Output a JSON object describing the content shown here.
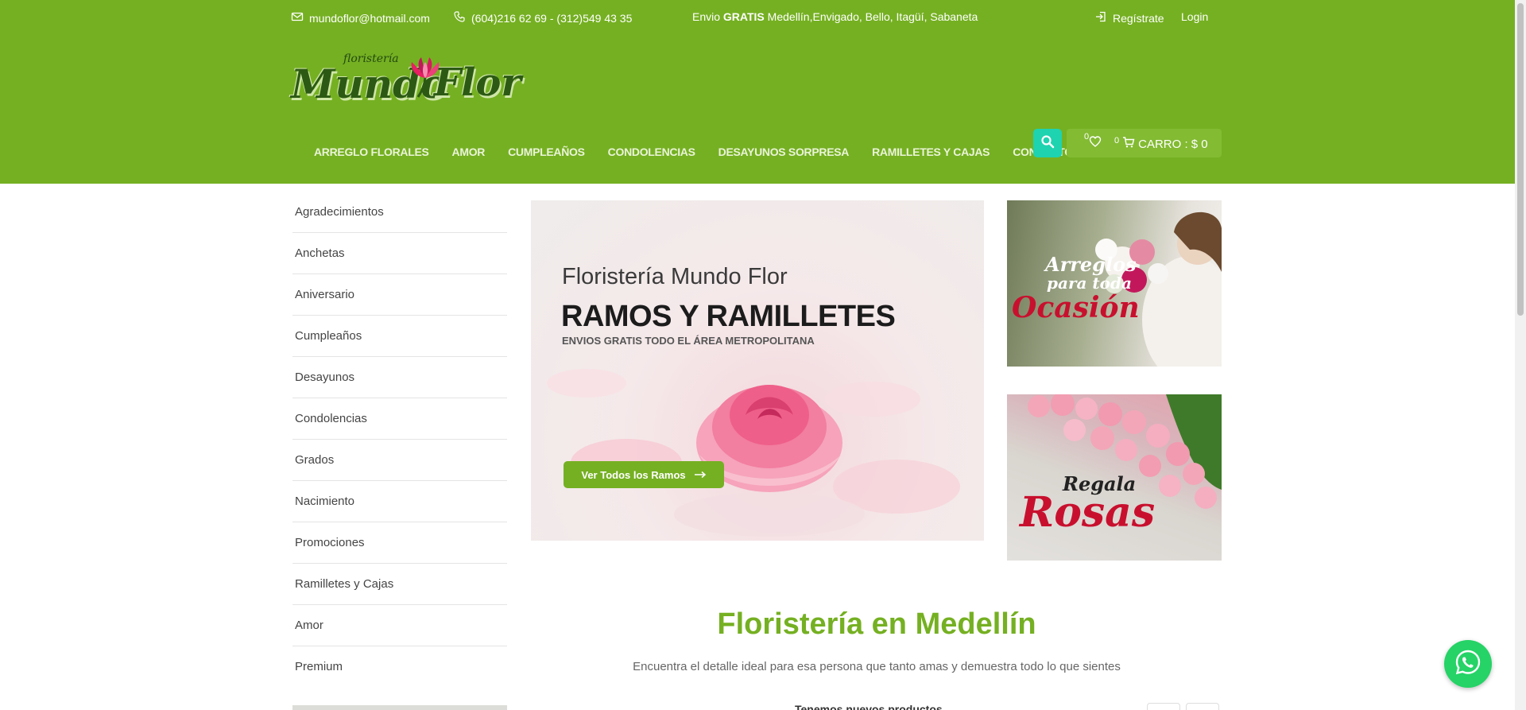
{
  "topbar": {
    "email": "mundoflor@hotmail.com",
    "phone": "(604)216 62 69 - (312)549 43 35",
    "shipping_prefix": "Envio",
    "shipping_bold": "GRATIS",
    "shipping_suffix": "Medellín,Envigado, Bello, Itagüí, Sabaneta",
    "register": "Regístrate",
    "login": "Login"
  },
  "logo": {
    "small": "floristería",
    "word1": "Mundo",
    "word2": "Flor"
  },
  "nav": [
    "ARREGLO FLORALES",
    "AMOR",
    "CUMPLEAÑOS",
    "CONDOLENCIAS",
    "DESAYUNOS SORPRESA",
    "RAMILLETES Y CAJAS",
    "CONTACTO"
  ],
  "cart": {
    "wishlist_count": "0",
    "cart_count": "0",
    "label": "CARRO : $ 0"
  },
  "sidebar": [
    "Agradecimientos",
    "Anchetas",
    "Aniversario",
    "Cumpleaños",
    "Desayunos",
    "Condolencias",
    "Grados",
    "Nacimiento",
    "Promociones",
    "Ramilletes y Cajas",
    "Amor",
    "Premium"
  ],
  "hero": {
    "subtitle": "Floristería Mundo Flor",
    "title": "RAMOS Y RAMILLETES",
    "tagline": "ENVIOS GRATIS TODO EL ÁREA METROPOLITANA",
    "button": "Ver Todos los Ramos"
  },
  "banner1": {
    "line1": "Arreglos",
    "line2": "para toda",
    "line3": "Ocasión"
  },
  "banner2": {
    "line1": "Regala",
    "line2": "Rosas"
  },
  "section": {
    "title": "Floristería en Medellín",
    "description": "Encuentra el detalle ideal para esa persona que tanto amas y demuestra todo lo que sientes",
    "subheading": "Tenemos nuevos productos"
  },
  "colors": {
    "brand_green": "#75b022",
    "search_teal": "#1ed3b0",
    "whatsapp": "#25d366"
  }
}
